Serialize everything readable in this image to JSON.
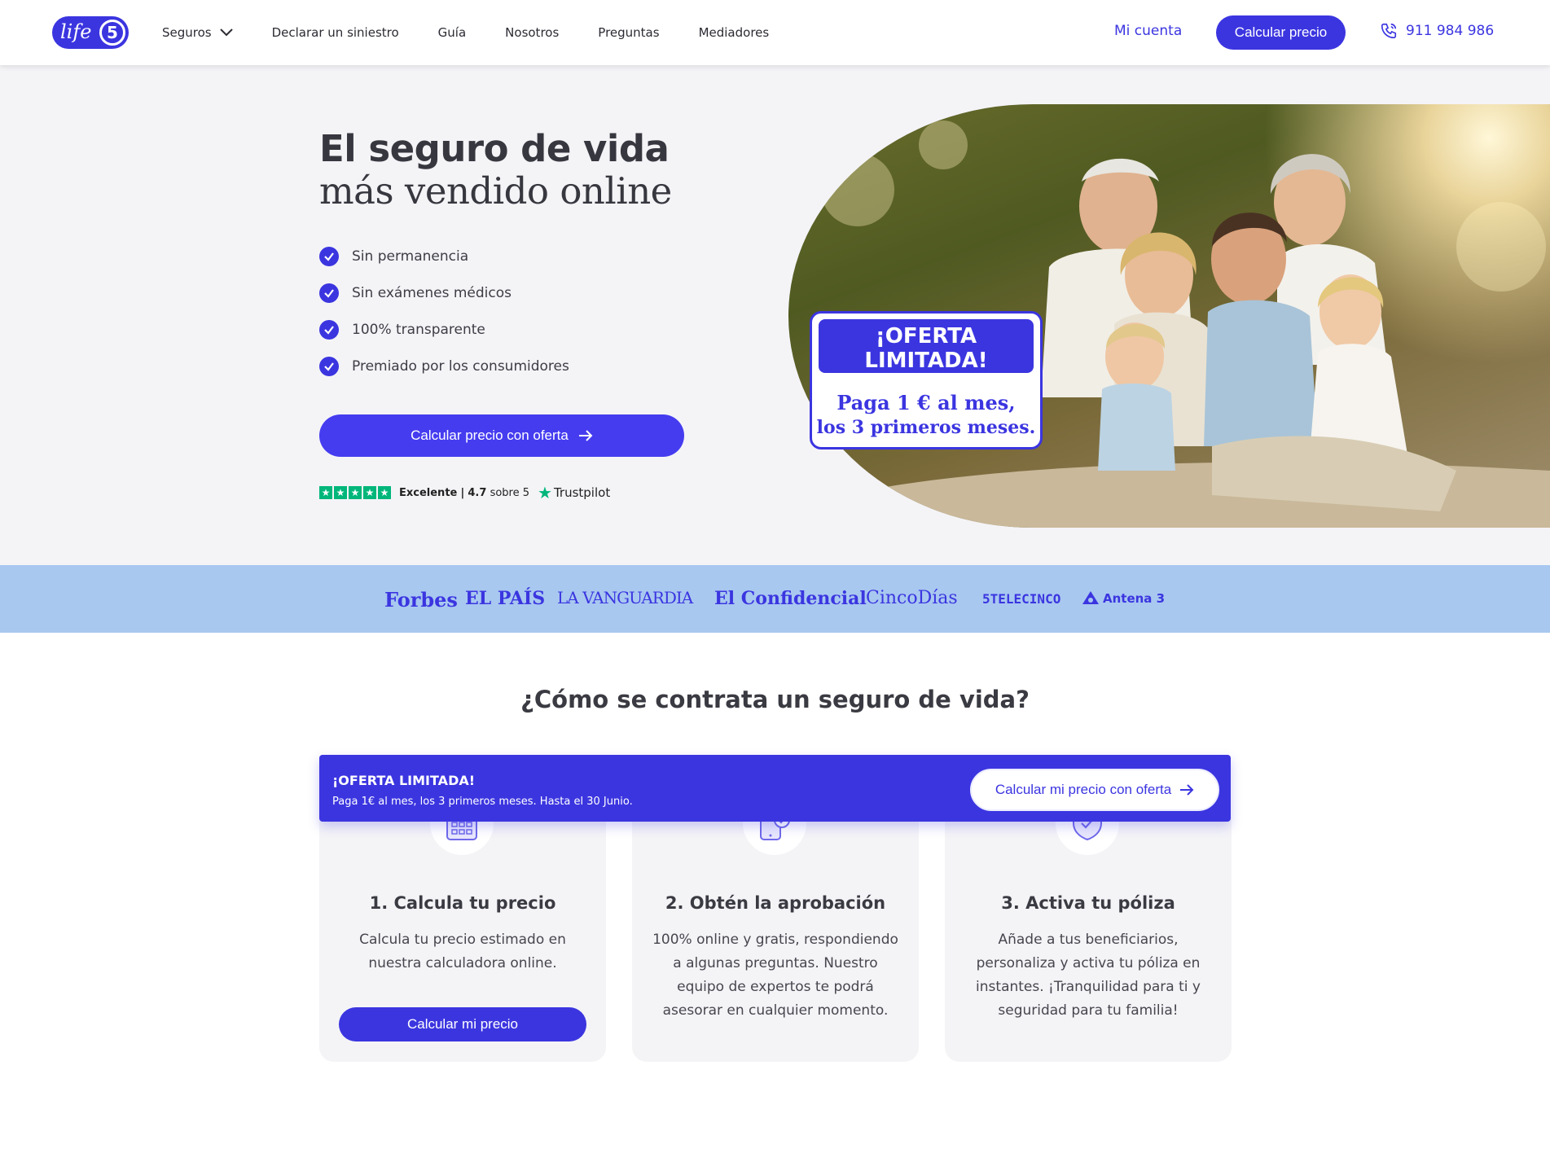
{
  "header": {
    "logo_text": "life",
    "logo_number": "5",
    "nav": [
      "Seguros",
      "Declarar un siniestro",
      "Guía",
      "Nosotros",
      "Preguntas",
      "Mediadores"
    ],
    "account_label": "Mi cuenta",
    "cta_label": "Calcular precio",
    "phone": "911 984 986"
  },
  "hero": {
    "title_line1": "El seguro de vida",
    "title_line2": "más vendido online",
    "features": [
      "Sin permanencia",
      "Sin exámenes médicos",
      "100% transparente",
      "Premiado por los consumidores"
    ],
    "cta_label": "Calcular precio con oferta",
    "trustpilot": {
      "rating_word": "Excelente",
      "separator": "|",
      "score": "4.7",
      "score_suffix": "sobre 5",
      "brand": "Trustpilot",
      "stars": 5
    },
    "offer_badge": {
      "title": "¡OFERTA LIMITADA!",
      "subtitle": "Hasta el 30 Junio.",
      "line1": "Paga  1 € al mes,",
      "line2": "los 3 primeros meses."
    }
  },
  "press": [
    "Forbes",
    "EL PAÍS",
    "LA VANGUARDIA",
    "El Confidencial",
    "CincoDías",
    "5TELECINCO",
    "Antena 3"
  ],
  "how": {
    "title": "¿Cómo se contrata un seguro de vida?",
    "offer_bar": {
      "title": "¡OFERTA LIMITADA!",
      "subtitle": "Paga 1€ al mes, los 3 primeros meses. Hasta el 30 Junio.",
      "button": "Calcular mi precio con oferta"
    },
    "steps": [
      {
        "icon": "calculator-icon",
        "title": "1. Calcula tu precio",
        "text": "Calcula tu precio estimado en nuestra calculadora online.",
        "button": "Calcular mi precio"
      },
      {
        "icon": "phone-check-icon",
        "title": "2. Obtén la aprobación",
        "text": "100% online y gratis, respondiendo a algunas preguntas. Nuestro equipo de expertos te podrá asesorar en cualquier momento."
      },
      {
        "icon": "shield-check-icon",
        "title": "3. Activa tu póliza",
        "text": "Añade a tus beneficiarios, personaliza y activa tu póliza en instantes. ¡Tranquilidad para ti y seguridad para tu familia!"
      }
    ]
  },
  "colors": {
    "brand": "#3b35e0",
    "hero_bg": "#f4f4f7",
    "press_bg": "#a8c8f0",
    "trustpilot_green": "#00b67a"
  }
}
